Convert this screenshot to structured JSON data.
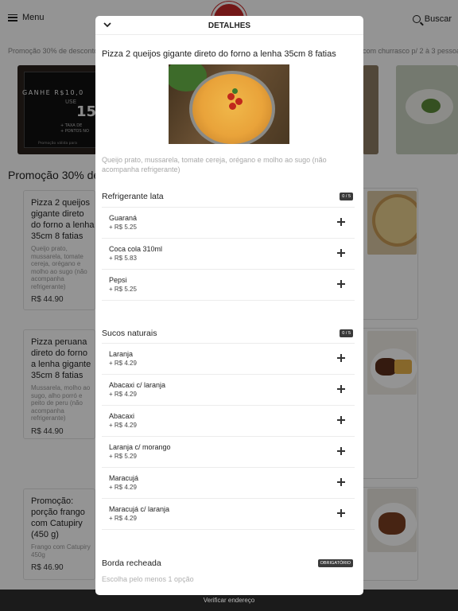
{
  "header": {
    "menu_label": "Menu",
    "search_label": "Buscar"
  },
  "promo_strip": {
    "left": "Promoção 30% de desconto",
    "right": "com churrasco p/ 2 à 3 pessoas"
  },
  "banner": {
    "line1": "GANHE R$10,0",
    "line2": "USE",
    "line3": "15",
    "line4": "+ TAXA DE",
    "line5": "+ PONTOS NO",
    "line6": "Promoção válida para"
  },
  "section": {
    "title": "Promoção 30% de"
  },
  "cards": [
    {
      "name": "Pizza 2 queijos gigante direto do forno a lenha 35cm 8 fatias",
      "desc": "Queijo prato, mussarela, tomate cereja, orégano e molho ao sugo (não acompanha refrigerante)",
      "price": "R$ 44.90"
    },
    {
      "name": "Pizza peruana direto do forno a lenha gigante 35cm 8 fatias",
      "desc": "Mussarela, molho ao sugo, alho porró e peito de peru (não acompanha refrigerante)",
      "price": "R$ 44.90"
    },
    {
      "name": "Promoção: porção frango com Catupiry (450 g)",
      "desc": "Frango com Catupiry 450g",
      "price": "R$ 46.90"
    }
  ],
  "footer": {
    "label": "Verificar endereço"
  },
  "modal": {
    "title": "DETALHES",
    "product_name": "Pizza 2 queijos gigante direto do forno a lenha 35cm 8 fatias",
    "product_desc": "Queijo prato, mussarela, tomate cereja, orégano e molho ao sugo (não acompanha refrigerante)",
    "groups": [
      {
        "name": "Refrigerante lata",
        "badge": "0 / 5",
        "options": [
          {
            "name": "Guaraná",
            "price": "+ R$ 5.25"
          },
          {
            "name": "Coca cola 310ml",
            "price": "+ R$ 5.83"
          },
          {
            "name": "Pepsi",
            "price": "+ R$ 5.25"
          }
        ]
      },
      {
        "name": "Sucos naturais",
        "badge": "0 / 5",
        "options": [
          {
            "name": "Laranja",
            "price": "+ R$ 4.29"
          },
          {
            "name": "Abacaxi c/ laranja",
            "price": "+ R$ 4.29"
          },
          {
            "name": "Abacaxi",
            "price": "+ R$ 4.29"
          },
          {
            "name": "Laranja c/ morango",
            "price": "+ R$ 5.29"
          },
          {
            "name": "Maracujá",
            "price": "+ R$ 4.29"
          },
          {
            "name": "Maracujá c/ laranja",
            "price": "+ R$ 4.29"
          }
        ]
      },
      {
        "name": "Borda recheada",
        "badge": "OBRIGATÓRIO",
        "rule": "Escolha pelo menos 1 opção"
      }
    ]
  }
}
